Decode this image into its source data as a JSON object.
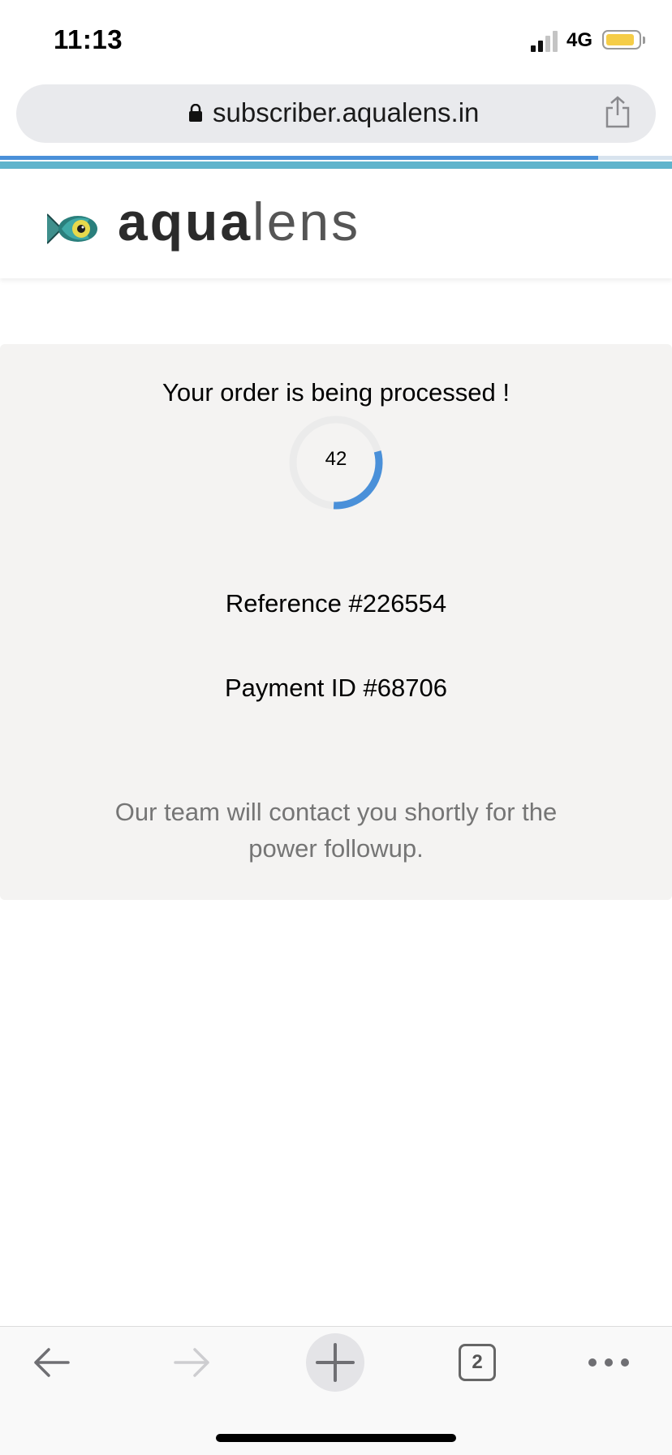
{
  "status_bar": {
    "time": "11:13",
    "network": "4G",
    "battery_level": 0.8
  },
  "browser": {
    "url": "subscriber.aqualens.in",
    "page_load_progress": 0.89,
    "tab_count": "2"
  },
  "brand": {
    "logo_bold": "aqua",
    "logo_light": "lens",
    "accent_color": "#5fb4cc"
  },
  "order": {
    "heading": "Your order is being processed !",
    "countdown": "42",
    "countdown_fraction": 0.3,
    "reference": "Reference #226554",
    "payment_id": "Payment ID #68706",
    "note": "Our team will contact you shortly for the power followup."
  },
  "toolbar": {
    "icons": [
      "back-arrow",
      "forward-arrow",
      "new-tab-plus",
      "tabs-count",
      "more-dots"
    ]
  }
}
